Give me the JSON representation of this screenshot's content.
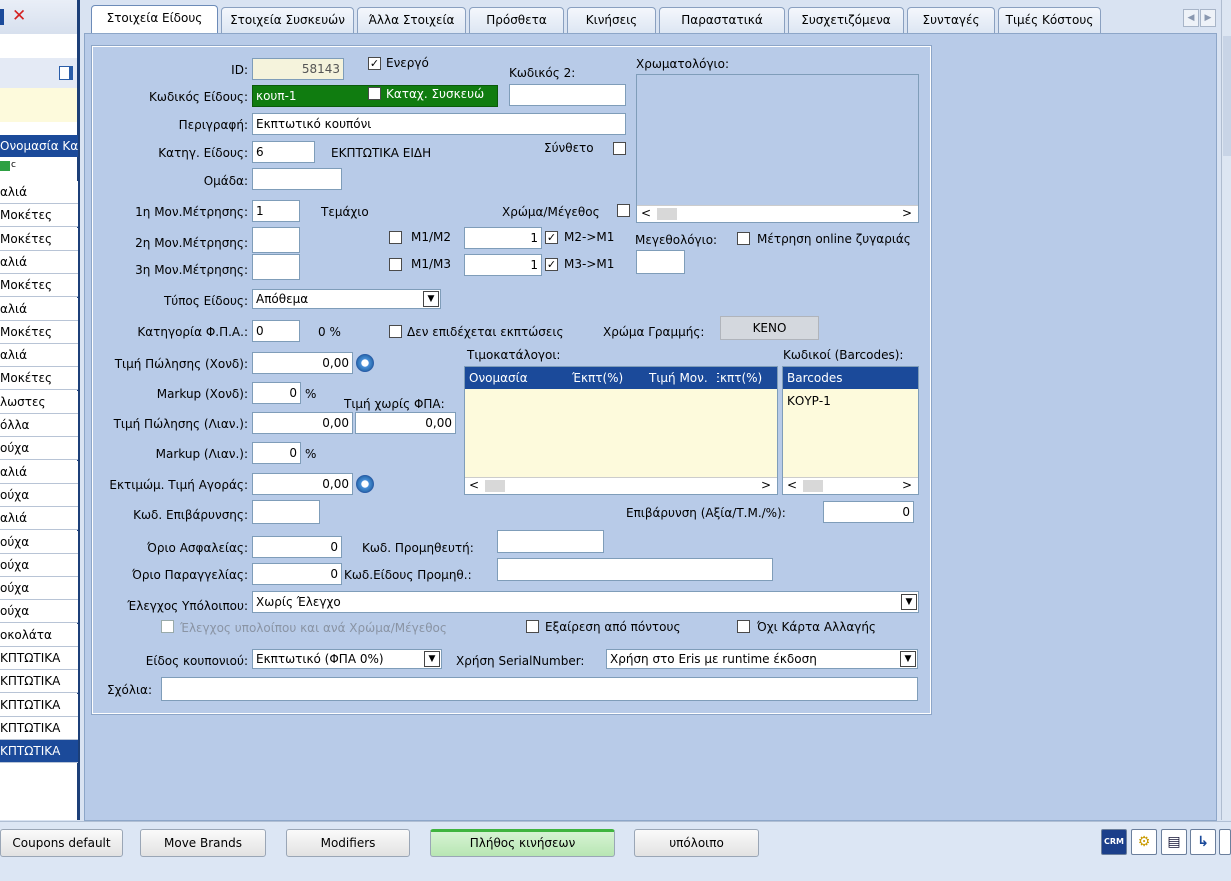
{
  "tabs": [
    "Στοιχεία Είδους",
    "Στοιχεία Συσκευών",
    "Άλλα Στοιχεία",
    "Πρόσθετα",
    "Κινήσεις",
    "Παραστατικά",
    "Συσχετιζόμενα",
    "Συνταγές",
    "Τιμές Κόστους"
  ],
  "left": {
    "close_glyph": "✕",
    "column_header": "Ονομασία Κα",
    "list_items": [
      "αλιά",
      "Μοκέτες",
      "Μοκέτες",
      "αλιά",
      "Μοκέτες",
      "αλιά",
      "Μοκέτες",
      "αλιά",
      "Μοκέτες",
      "λωστες",
      "όλλα",
      "ούχα",
      "αλιά",
      "ούχα",
      "αλιά",
      "ούχα",
      "ούχα",
      "ούχα",
      "ούχα",
      "οκολάτα",
      "ΚΠΤΩΤΙΚΑ",
      "ΚΠΤΩΤΙΚΑ",
      "ΚΠΤΩΤΙΚΑ",
      "ΚΠΤΩΤΙΚΑ",
      "ΚΠΤΩΤΙΚΑ"
    ]
  },
  "form": {
    "id_label": "ID:",
    "id_value": "58143",
    "active_label": "Ενεργό",
    "code2_label": "Κωδικός 2:",
    "code2_value": "",
    "palette_label": "Χρωματολόγιο:",
    "code_label": "Κωδικός Είδους:",
    "code_value": "κουπ-1",
    "device_label": "Καταχ. Συσκευώ",
    "description_label": "Περιγραφή:",
    "description_value": "Εκπτωτικό κουπόνι",
    "category_label": "Κατηγ. Είδους:",
    "category_value": "6",
    "category_name": "ΕΚΠΤΩΤΙΚΑ ΕΙΔΗ",
    "composite_label": "Σύνθετο",
    "group_label": "Ομάδα:",
    "group_value": "",
    "uom1_label": "1η Μον.Μέτρησης:",
    "uom1_value": "1",
    "uom1_name": "Τεμάχιο",
    "color_size_label": "Χρώμα/Μέγεθος",
    "uom2_label": "2η Μον.Μέτρησης:",
    "uom3_label": "3η Μον.Μέτρησης:",
    "m1m2_label": "M1/M2",
    "m1m2_value": "1",
    "m2m1_label": "M2->M1",
    "m1m3_label": "M1/M3",
    "m1m3_value": "1",
    "m3m1_label": "M3->M1",
    "sizes_label": "Μεγεθολόγιο:",
    "online_scale_label": "Μέτρηση online ζυγαριάς",
    "item_type_label": "Τύπος Είδους:",
    "item_type_value": "Απόθεμα",
    "vat_cat_label": "Κατηγορία Φ.Π.Α.:",
    "vat_cat_value": "0",
    "vat_pct": "0 %",
    "no_discount_label": "Δεν επιδέχεται εκπτώσεις",
    "row_color_label": "Χρώμα Γραμμής:",
    "row_color_value": "ΚΕΝΟ",
    "wholesale_price_label": "Τιμή Πώλησης (Χονδ):",
    "wholesale_price_value": "0,00",
    "pricelists_label": "Τιμοκατάλογοι:",
    "barcodes_label": "Κωδικοί (Barcodes):",
    "markup_w_label": "Markup (Χονδ):",
    "markup_w_value": "0",
    "pct": "%",
    "net_price_label": "Τιμή χωρίς ΦΠΑ:",
    "retail_price_label": "Τιμή Πώλησης (Λιαν.):",
    "retail_price_value": "0,00",
    "net_price_value": "0,00",
    "markup_r_label": "Markup (Λιαν.):",
    "markup_r_value": "0",
    "est_cost_label": "Εκτιμώμ. Τιμή Αγοράς:",
    "est_cost_value": "0,00",
    "surcharge_code_label": "Κωδ. Επιβάρυνσης:",
    "surcharge_label": "Επιβάρυνση (Αξία/Τ.Μ./%):",
    "surcharge_value": "0",
    "safety_label": "Όριο Ασφαλείας:",
    "safety_value": "0",
    "supplier_code_label": "Κωδ. Προμηθευτή:",
    "reorder_label": "Όριο Παραγγελίας:",
    "reorder_value": "0",
    "supplier_item_label": "Κωδ.Είδους Προμηθ.:",
    "balance_check_label": "Έλεγχος Υπόλοιπου:",
    "balance_check_value": "Χωρίς Έλεγχο",
    "balance_color_label": "Έλεγχος υπολοίπου και ανά Χρώμα/Μέγεθος",
    "exclude_points_label": "Εξαίρεση από πόντους",
    "no_exchange_label": "Όχι Κάρτα Αλλαγής",
    "coupon_type_label": "Είδος κουπονιού:",
    "coupon_type_value": "Εκπτωτικό (ΦΠΑ 0%)",
    "serial_label": "Χρήση SerialNumber:",
    "serial_value": "Χρήση στο Eris με runtime έκδοση",
    "comments_label": "Σχόλια:"
  },
  "pricelist_grid": {
    "headers": [
      "Ονομασία",
      "Έκπτ(%)",
      "Τιμή Μον.",
      "Έκπτ(%)"
    ]
  },
  "barcode_grid": {
    "header": "Barcodes",
    "rows": [
      "ΚΟΥΡ-1"
    ]
  },
  "scroll_left": "<",
  "scroll_right": ">",
  "bottom": {
    "buttons": [
      "Coupons default",
      "Move Brands",
      "Modifiers",
      "Πλήθος κινήσεων",
      "υπόλοιπο"
    ],
    "crm_label": "CRM"
  },
  "colors": {
    "accent": "#1b4a9a",
    "code_bg": "#107c10",
    "frame": "#1c3f78"
  }
}
